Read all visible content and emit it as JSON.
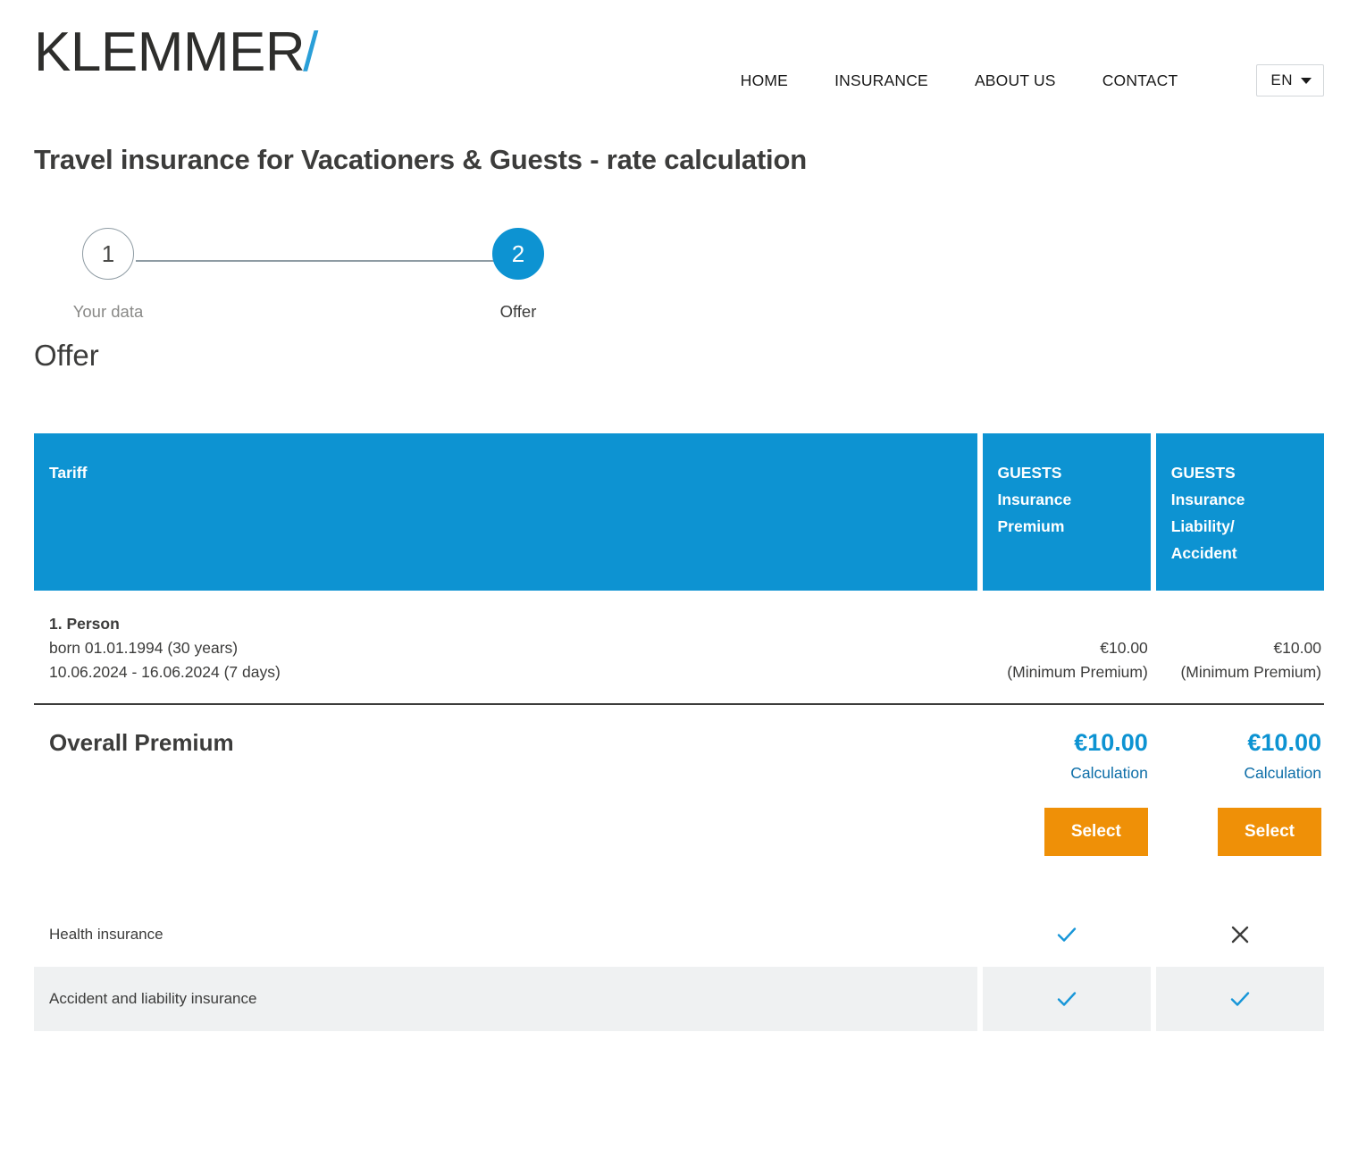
{
  "header": {
    "logo_word": "KLEMMER",
    "logo_slash": "/",
    "nav": [
      {
        "label": "HOME",
        "name": "nav-home"
      },
      {
        "label": "INSURANCE",
        "name": "nav-insurance"
      },
      {
        "label": "ABOUT US",
        "name": "nav-about-us"
      },
      {
        "label": "CONTACT",
        "name": "nav-contact"
      }
    ],
    "language": {
      "selected": "EN",
      "icon": "chevron-down-icon"
    }
  },
  "page": {
    "title": "Travel insurance for Vacationers & Guests - rate calculation",
    "section_title": "Offer"
  },
  "stepper": {
    "steps": [
      {
        "number": "1",
        "label": "Your data",
        "state": "inactive"
      },
      {
        "number": "2",
        "label": "Offer",
        "state": "active"
      }
    ]
  },
  "offer_table": {
    "head": {
      "tariff": "Tariff",
      "columns": [
        {
          "line1": "GUESTS",
          "line2": "Insurance",
          "line3": "Premium",
          "line4": ""
        },
        {
          "line1": "GUESTS",
          "line2": "Insurance",
          "line3": "Liability/",
          "line4": "Accident"
        }
      ]
    },
    "person_row": {
      "name": "1. Person",
      "born": "born 01.01.1994 (30 years)",
      "period": "10.06.2024 - 16.06.2024 (7 days)",
      "values": [
        {
          "price": "€10.00",
          "note": "(Minimum Premium)"
        },
        {
          "price": "€10.00",
          "note": "(Minimum Premium)"
        }
      ]
    },
    "overall": {
      "label": "Overall Premium",
      "values": [
        {
          "price": "€10.00",
          "calculation_link": "Calculation",
          "select_label": "Select"
        },
        {
          "price": "€10.00",
          "calculation_link": "Calculation",
          "select_label": "Select"
        }
      ]
    },
    "features": [
      {
        "label": "Health insurance",
        "marks": [
          "check",
          "cross"
        ],
        "alt": false
      },
      {
        "label": "Accident and liability insurance",
        "marks": [
          "check",
          "check"
        ],
        "alt": true
      }
    ]
  },
  "colors": {
    "brand_blue": "#0d93d2",
    "accent_orange": "#ef9007",
    "link_blue": "#0d6ea8",
    "text_dark": "#3c3c3b",
    "row_alt": "#eff1f2"
  }
}
